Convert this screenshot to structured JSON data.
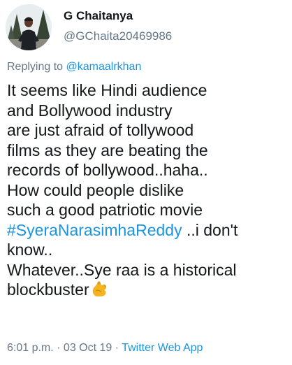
{
  "user": {
    "display_name": "G Chaitanya",
    "handle": "@GChaita20469986"
  },
  "reply": {
    "prefix": "Replying to ",
    "mention": "@kamaalrkhan"
  },
  "tweet": {
    "lines": [
      "It seems like Hindi audience",
      "and Bollywood industry",
      "are just afraid of tollywood",
      "films as they are beating the",
      "records of bollywood..haha..",
      "How could people dislike",
      "such a good patriotic movie"
    ],
    "hashtag": "#SyeraNarasimhaReddy",
    "after_hashtag": " ..i don't",
    "line_know": "know..",
    "line_whatever": "Whatever..Sye raa is a historical",
    "line_last": "blockbuster",
    "emoji": "flexed-biceps-icon"
  },
  "meta": {
    "time": "6:01 p.m.",
    "sep1": " · ",
    "date": "03 Oct 19",
    "sep2": " · ",
    "source": "Twitter Web App"
  },
  "colors": {
    "link": "#1b95e0",
    "secondary": "#657786",
    "text": "#14171a"
  }
}
